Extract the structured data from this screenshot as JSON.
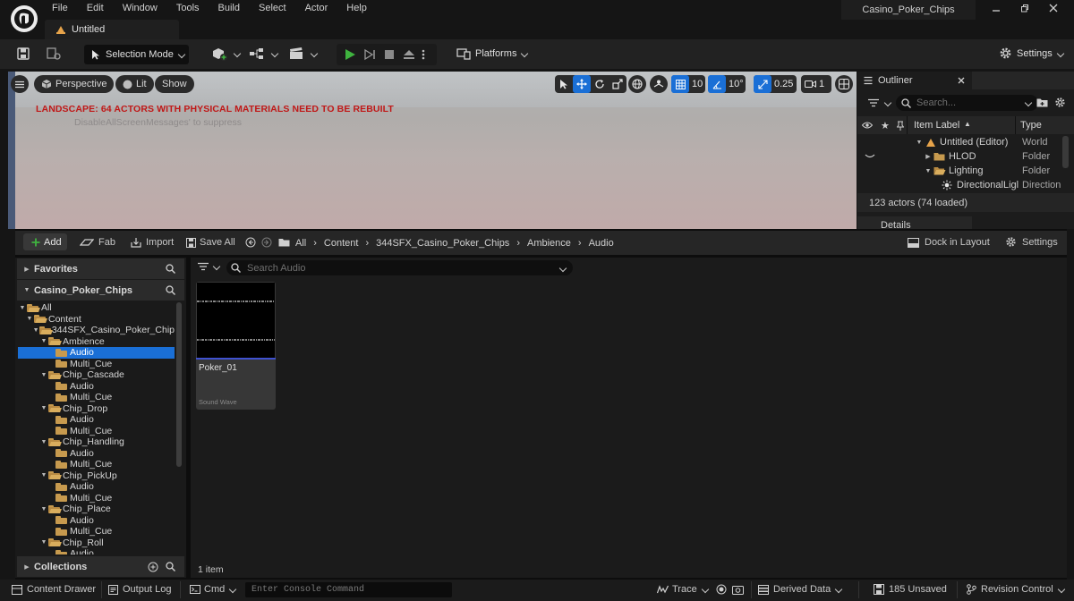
{
  "menu": [
    "File",
    "Edit",
    "Window",
    "Tools",
    "Build",
    "Select",
    "Actor",
    "Help"
  ],
  "document_tab": "Untitled",
  "project_title": "Casino_Poker_Chips",
  "toolbar": {
    "selection_mode": "Selection Mode",
    "platforms": "Platforms",
    "settings": "Settings"
  },
  "viewport": {
    "perspective": "Perspective",
    "lit": "Lit",
    "show": "Show",
    "grid_snap": "10",
    "rotation_snap": "10°",
    "scale_snap": "0.25",
    "camera_speed": "1",
    "warning": "LANDSCAPE: 64 ACTORS WITH PHYSICAL MATERIALS NEED TO BE REBUILT",
    "suppress_hint": "DisableAllScreenMessages' to suppress"
  },
  "outliner": {
    "tab": "Outliner",
    "search_placeholder": "Search...",
    "col_label": "Item Label",
    "col_type": "Type",
    "rows": [
      {
        "label": "Untitled (Editor)",
        "type": "World"
      },
      {
        "label": "HLOD",
        "type": "Folder"
      },
      {
        "label": "Lighting",
        "type": "Folder"
      },
      {
        "label": "DirectionalLigl",
        "type": "Direction"
      }
    ],
    "actor_count": "123 actors (74 loaded)",
    "details_tab": "Details"
  },
  "content_browser": {
    "add": "Add",
    "fab": "Fab",
    "import": "Import",
    "save_all": "Save All",
    "breadcrumb": [
      "All",
      "Content",
      "344SFX_Casino_Poker_Chips",
      "Ambience",
      "Audio"
    ],
    "dock_in_layout": "Dock in Layout",
    "settings": "Settings",
    "favorites": "Favorites",
    "project_section": "Casino_Poker_Chips",
    "collections": "Collections",
    "search_placeholder": "Search Audio",
    "tree": [
      {
        "label": "All",
        "level": 0
      },
      {
        "label": "Content",
        "level": 1
      },
      {
        "label": "344SFX_Casino_Poker_Chip",
        "level": 2
      },
      {
        "label": "Ambience",
        "level": 3
      },
      {
        "label": "Audio",
        "level": 4
      },
      {
        "label": "Multi_Cue",
        "level": 4
      },
      {
        "label": "Chip_Cascade",
        "level": 3
      },
      {
        "label": "Audio",
        "level": 4
      },
      {
        "label": "Multi_Cue",
        "level": 4
      },
      {
        "label": "Chip_Drop",
        "level": 3
      },
      {
        "label": "Audio",
        "level": 4
      },
      {
        "label": "Multi_Cue",
        "level": 4
      },
      {
        "label": "Chip_Handling",
        "level": 3
      },
      {
        "label": "Audio",
        "level": 4
      },
      {
        "label": "Multi_Cue",
        "level": 4
      },
      {
        "label": "Chip_PickUp",
        "level": 3
      },
      {
        "label": "Audio",
        "level": 4
      },
      {
        "label": "Multi_Cue",
        "level": 4
      },
      {
        "label": "Chip_Place",
        "level": 3
      },
      {
        "label": "Audio",
        "level": 4
      },
      {
        "label": "Multi_Cue",
        "level": 4
      },
      {
        "label": "Chip_Roll",
        "level": 3
      },
      {
        "label": "Audio",
        "level": 4
      }
    ],
    "asset": {
      "name": "Poker_01",
      "type": "Sound Wave"
    },
    "item_count": "1 item"
  },
  "statusbar": {
    "content_drawer": "Content Drawer",
    "output_log": "Output Log",
    "cmd": "Cmd",
    "console_placeholder": "Enter Console Command",
    "trace": "Trace",
    "derived_data": "Derived Data",
    "unsaved": "185 Unsaved",
    "revision_control": "Revision Control"
  },
  "colors": {
    "accent": "#1a6fd6",
    "play": "#3fb33f",
    "warning": "#c01818"
  }
}
